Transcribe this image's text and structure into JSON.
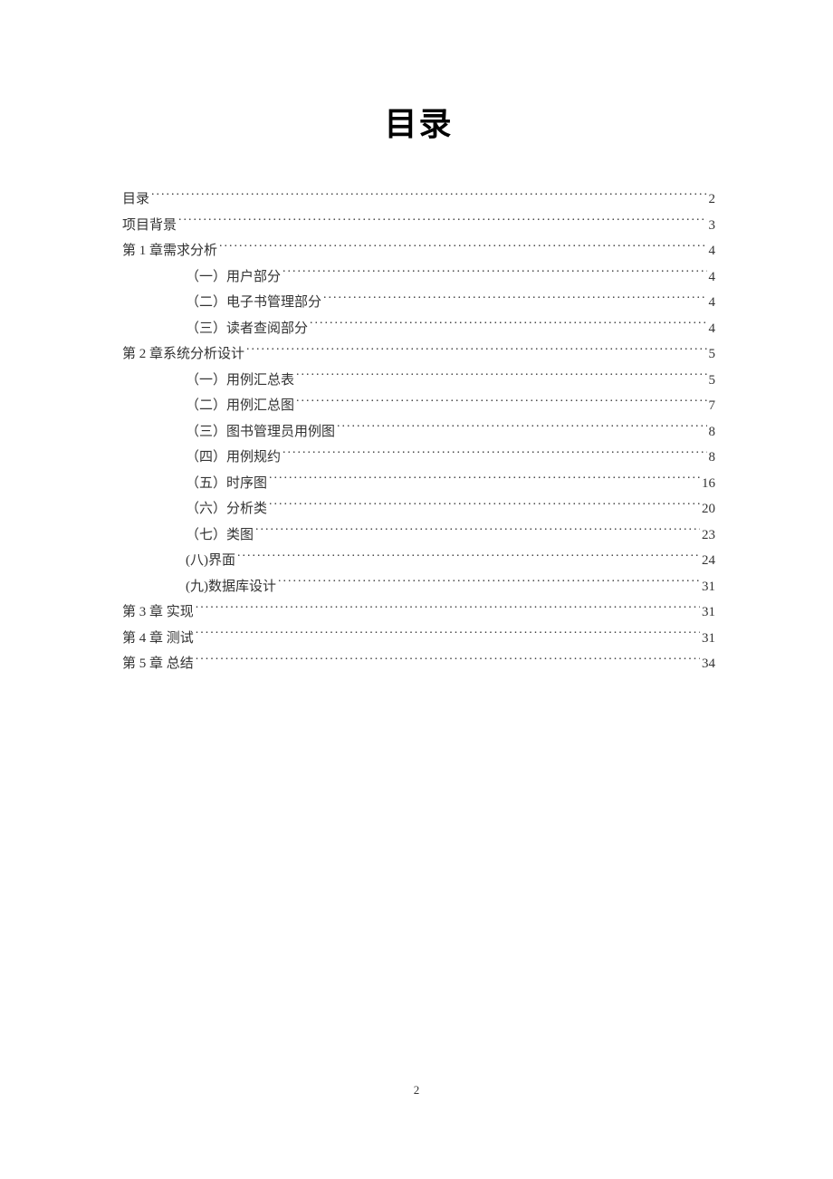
{
  "title": "目录",
  "page_number": "2",
  "toc": [
    {
      "level": 1,
      "label": "目录",
      "page": "2"
    },
    {
      "level": 1,
      "label": "项目背景",
      "page": "3"
    },
    {
      "level": 1,
      "label": "第 1 章需求分析",
      "page": "4"
    },
    {
      "level": 2,
      "label": "（一）用户部分",
      "page": "4"
    },
    {
      "level": 2,
      "label": "（二）电子书管理部分",
      "page": "4"
    },
    {
      "level": 2,
      "label": "（三）读者查阅部分",
      "page": "4"
    },
    {
      "level": 1,
      "label": "第 2 章系统分析设计",
      "page": "5"
    },
    {
      "level": 2,
      "label": "（一）用例汇总表",
      "page": "5"
    },
    {
      "level": 2,
      "label": "（二）用例汇总图",
      "page": "7"
    },
    {
      "level": 2,
      "label": "（三）图书管理员用例图",
      "page": "8"
    },
    {
      "level": 2,
      "label": "（四）用例规约",
      "page": "8"
    },
    {
      "level": 2,
      "label": "（五）时序图",
      "page": "16"
    },
    {
      "level": 2,
      "label": "（六）分析类",
      "page": "20"
    },
    {
      "level": 2,
      "label": "（七）类图",
      "page": "23"
    },
    {
      "level": 2,
      "label": "(八)界面",
      "page": "24"
    },
    {
      "level": 2,
      "label": "(九)数据库设计",
      "page": "31"
    },
    {
      "level": 1,
      "label": "第 3 章  实现",
      "page": "31"
    },
    {
      "level": 1,
      "label": "第 4 章  测试",
      "page": "31"
    },
    {
      "level": 1,
      "label": "第 5 章  总结",
      "page": "34"
    }
  ]
}
